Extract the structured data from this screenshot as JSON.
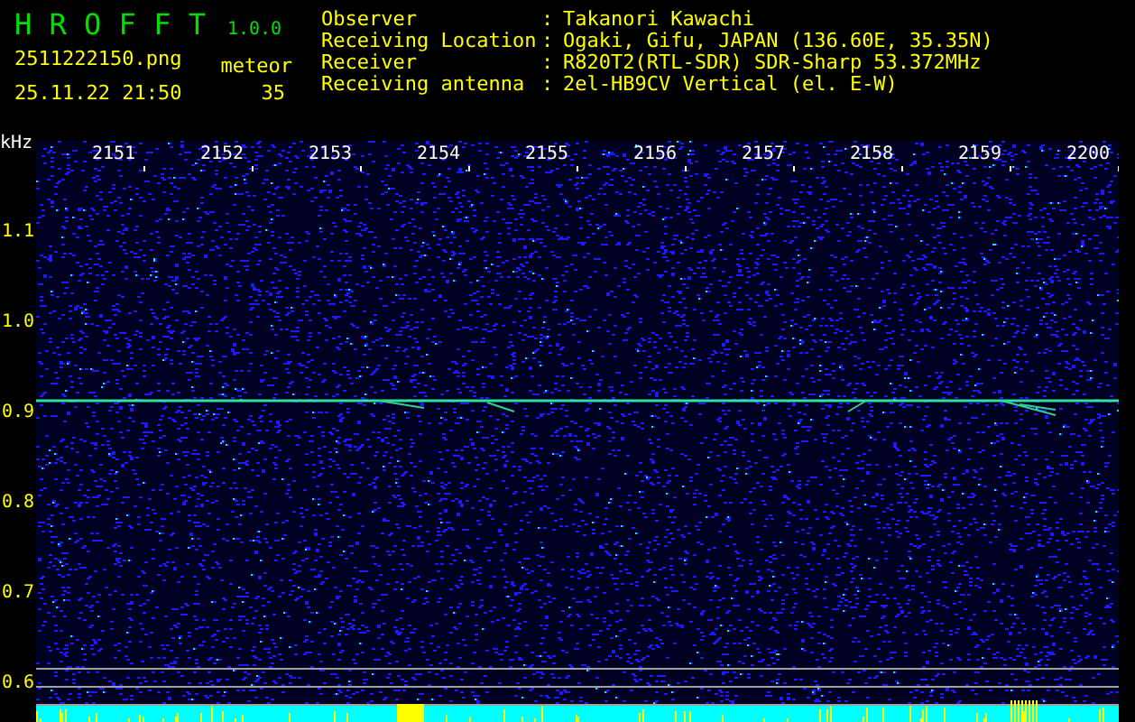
{
  "app": {
    "name": "H R O F F T",
    "version": "1.0.0"
  },
  "file": {
    "name": "2511222150.png",
    "datetime": "25.11.22 21:50"
  },
  "count": {
    "label": "meteor",
    "value": "35"
  },
  "station": [
    {
      "label": "Observer",
      "separator": ":",
      "value": "Takanori Kawachi"
    },
    {
      "label": "Receiving Location",
      "separator": ":",
      "value": "Ogaki, Gifu, JAPAN (136.60E, 35.35N)"
    },
    {
      "label": "Receiver",
      "separator": ":",
      "value": "R820T2(RTL-SDR) SDR-Sharp 53.372MHz"
    },
    {
      "label": "Receiving antenna",
      "separator": ":",
      "value": "2el-HB9CV Vertical (el. E-W)"
    }
  ],
  "spectrogram": {
    "unit": "kHz",
    "time_labels": [
      "2151",
      "2152",
      "2153",
      "2154",
      "2155",
      "2156",
      "2157",
      "2158",
      "2159",
      "2200"
    ],
    "frequency_labels": [
      "1.1",
      "1.0",
      "0.9",
      "0.8",
      "0.7",
      "0.6"
    ]
  }
}
